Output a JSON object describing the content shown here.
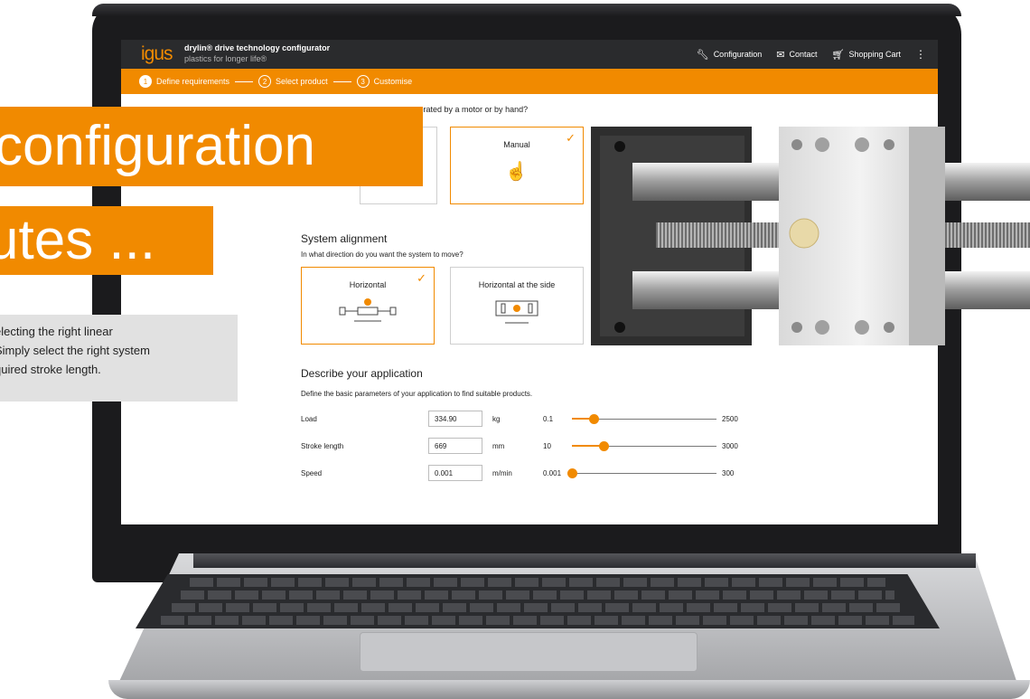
{
  "header": {
    "logo": "igus",
    "title": "drylin® drive technology configurator",
    "subtitle": "plastics for longer life®",
    "nav": [
      {
        "label": "Configuration",
        "icon": "wrench-icon"
      },
      {
        "label": "Contact",
        "icon": "mail-icon"
      },
      {
        "label": "Shopping Cart",
        "icon": "cart-icon"
      }
    ]
  },
  "steps": [
    {
      "number": "1",
      "label": "Define requirements",
      "active": true
    },
    {
      "number": "2",
      "label": "Select product",
      "active": false
    },
    {
      "number": "3",
      "label": "Customise",
      "active": false
    }
  ],
  "operation": {
    "question": "e operated by a motor or by hand?",
    "options": [
      {
        "label": "",
        "selected": false
      },
      {
        "label": "Manual",
        "selected": true
      }
    ]
  },
  "alignment": {
    "heading": "System alignment",
    "question": "In what direction do you want the system to move?",
    "options": [
      {
        "label": "Horizontal",
        "selected": true
      },
      {
        "label": "Horizontal at the side",
        "selected": false
      }
    ]
  },
  "application": {
    "heading": "Describe your application",
    "description": "Define the basic parameters of your application to find suitable products.",
    "params": [
      {
        "name": "Load",
        "value": "334.90",
        "unit": "kg",
        "min": "0.1",
        "max": "2500",
        "position": 0.15
      },
      {
        "name": "Stroke length",
        "value": "669",
        "unit": "mm",
        "min": "10",
        "max": "3000",
        "position": 0.22
      },
      {
        "name": "Speed",
        "value": "0.001",
        "unit": "m/min",
        "min": "0.001",
        "max": "300",
        "position": 0.0
      }
    ]
  },
  "overlay": {
    "line1": "configuration",
    "line2": "utes ...",
    "body": [
      "electing the right linear",
      "Simply select the right system",
      "quired stroke length."
    ]
  },
  "colors": {
    "accent": "#f18a00",
    "header_bg": "#2a2b2d"
  }
}
